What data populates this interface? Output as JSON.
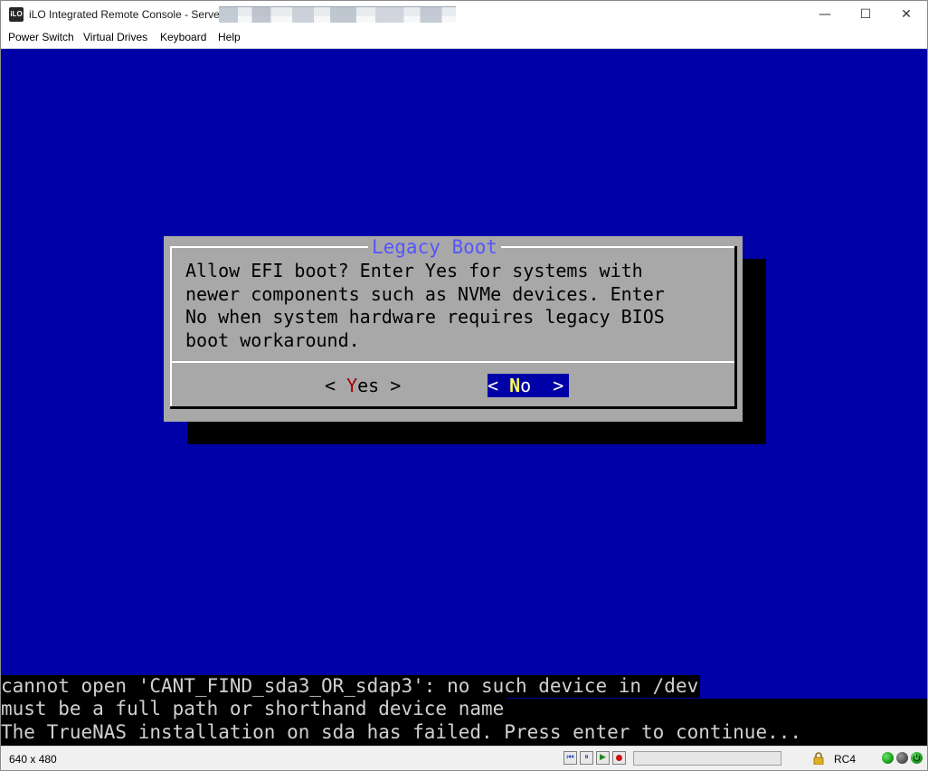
{
  "window": {
    "title": "iLO Integrated Remote Console - Server:",
    "app_icon_text": "iLO",
    "controls": {
      "minimize": "—",
      "maximize": "☐",
      "close": "✕"
    }
  },
  "menu": {
    "items": [
      {
        "label": "Power Switch"
      },
      {
        "label": "Virtual Drives"
      },
      {
        "label": "Keyboard"
      },
      {
        "label": "Help"
      }
    ]
  },
  "dialog": {
    "title": "Legacy Boot",
    "message": "Allow EFI boot? Enter Yes for systems with\nnewer components such as NVMe devices. Enter\nNo when system hardware requires legacy BIOS\nboot workaround.",
    "yes": {
      "left": "< ",
      "hotkey": "Y",
      "rest": "es >"
    },
    "no": {
      "left": "< ",
      "hotkey": "N",
      "rest": "o  >",
      "selected": true
    }
  },
  "console": {
    "lines": [
      "cannot open 'CANT_FIND_sda3_OR_sdap3': no such device in /dev",
      "must be a full path or shorthand device name",
      "The TrueNAS installation on sda has failed. Press enter to continue..."
    ]
  },
  "status": {
    "resolution": "640 x 480",
    "encryption": "RC4",
    "playback_icons": [
      "skip-back-icon",
      "pause-icon",
      "play-icon",
      "record-icon"
    ],
    "indicators": [
      {
        "name": "green-status-icon",
        "color": "#1aa01a"
      },
      {
        "name": "gray-status-icon",
        "color": "#555555"
      },
      {
        "name": "power-status-icon",
        "color": "#1aa01a"
      }
    ]
  },
  "colors": {
    "console_background": "#0000a8",
    "dialog_background": "#a8a8a8",
    "dialog_title": "#5555ff",
    "hotkey_yes": "#a80000",
    "hotkey_no": "#ffff55"
  }
}
